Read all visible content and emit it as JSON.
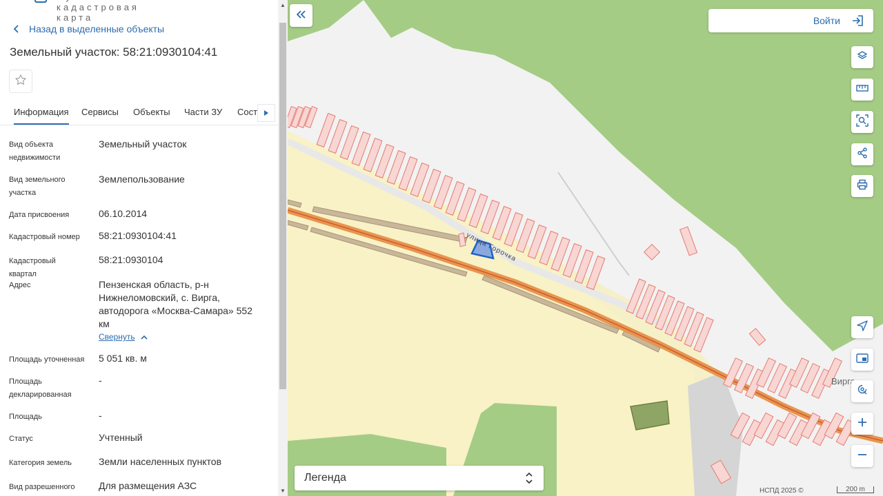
{
  "header": {
    "partial_title": "Публичная кадастровая карта"
  },
  "panel": {
    "back_label": "Назад в выделенные объекты",
    "title": "Земельный участок: 58:21:0930104:41",
    "tabs": [
      {
        "label": "Информация",
        "active": true
      },
      {
        "label": "Сервисы"
      },
      {
        "label": "Объекты"
      },
      {
        "label": "Части ЗУ"
      },
      {
        "label": "Соста"
      }
    ],
    "fields": [
      {
        "label": "Вид объекта недвижимости",
        "value": "Земельный участок"
      },
      {
        "label": "Вид земельного участка",
        "value": "Землепользование"
      },
      {
        "label": "Дата присвоения",
        "value": "06.10.2014"
      },
      {
        "label": "Кадастровый номер",
        "value": "58:21:0930104:41"
      },
      {
        "label": "Кадастровый квартал",
        "value": "58:21:0930104"
      },
      {
        "label": "Адрес",
        "value": "Пензенская область, р-н Нижнеломовский, с. Вирга, автодорога «Москва-Самара» 552 км"
      },
      {
        "label": "Площадь уточненная",
        "value": "5 051 кв. м"
      },
      {
        "label": "Площадь декларированная",
        "value": "-"
      },
      {
        "label": "Площадь",
        "value": "-"
      },
      {
        "label": "Статус",
        "value": "Учтенный"
      },
      {
        "label": "Категория земель",
        "value": "Земли населенных пунктов"
      },
      {
        "label": "Вид разрешенного",
        "value": "Для размещения АЗС"
      }
    ],
    "collapse_label": "Свернуть"
  },
  "map": {
    "login_label": "Войти",
    "legend_label": "Легенда",
    "street_label": "улица Горочка",
    "town_label": "Вирга",
    "attribution": "НСПД 2025 ©",
    "scale_label": "200 m",
    "colors": {
      "forest": "#a5cc85",
      "field": "#f8f2c6",
      "parcel_fill": "#f8d6d3",
      "parcel_stroke": "#e47b72",
      "road": "#e8954f",
      "selected_fill": "#8aa8e0",
      "selected_stroke": "#1d63c8",
      "accent": "#2b6cb0"
    },
    "tools": [
      "layers-icon",
      "ruler-icon",
      "select-area-icon",
      "share-icon",
      "print-icon",
      "locate-icon",
      "minimap-icon",
      "search-location-icon",
      "zoom-in-icon",
      "zoom-out-icon"
    ]
  }
}
